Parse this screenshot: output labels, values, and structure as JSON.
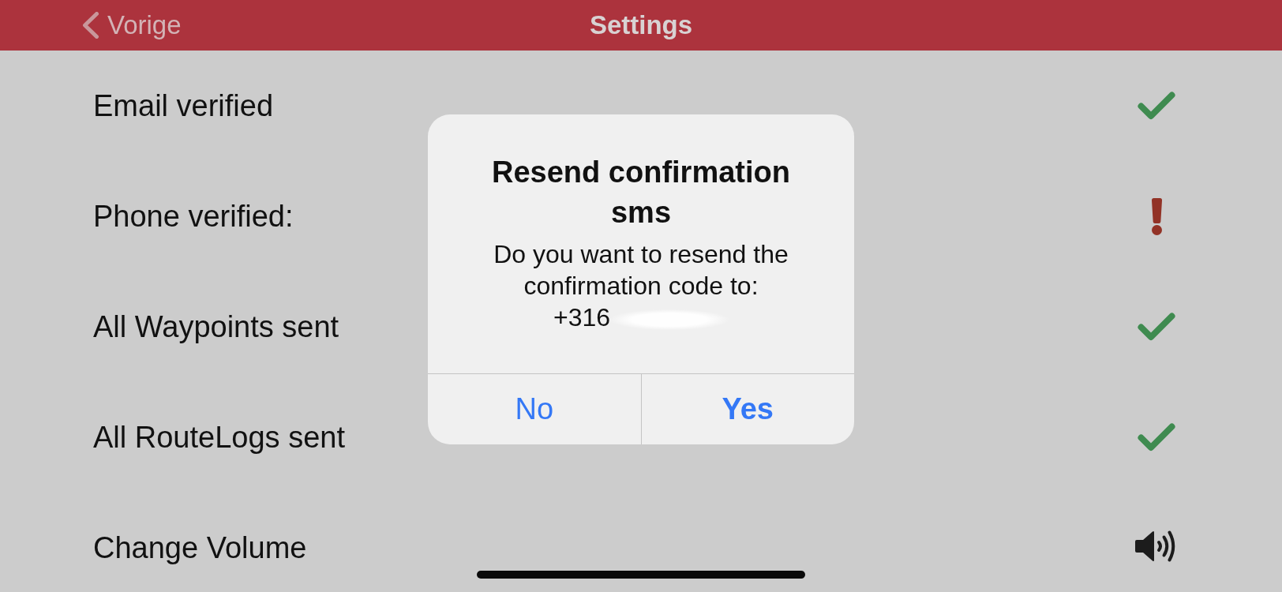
{
  "nav_bar": {
    "back_label": "Vorige",
    "title": "Settings"
  },
  "rows": [
    {
      "label": "Email verified",
      "kind": "check"
    },
    {
      "label": "Phone verified:",
      "kind": "alert"
    },
    {
      "label": "All Waypoints sent",
      "kind": "check"
    },
    {
      "label": "All RouteLogs sent",
      "kind": "check"
    },
    {
      "label": "Change Volume",
      "kind": "volume"
    }
  ],
  "dialog": {
    "title": "Resend confirmation sms",
    "message": "Do you want to resend the confirmation code to:",
    "phone": "+316",
    "buttons": [
      {
        "label": "No",
        "kind": "cancel"
      },
      {
        "label": "Yes",
        "kind": "default"
      }
    ]
  }
}
